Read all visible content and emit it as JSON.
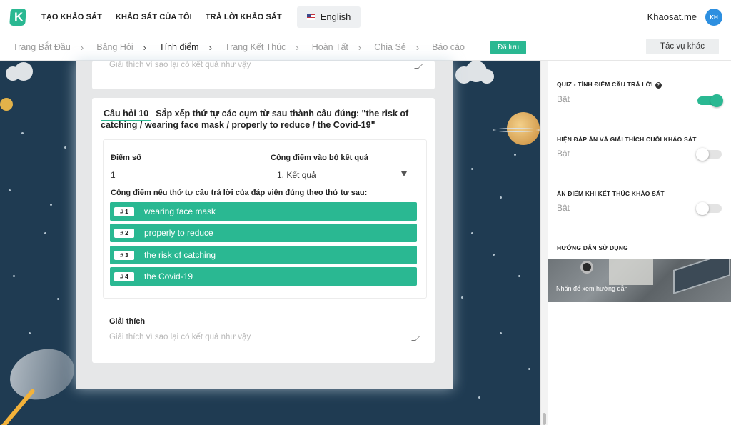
{
  "nav": {
    "links": [
      "TẠO KHẢO SÁT",
      "KHẢO SÁT CỦA TÔI",
      "TRẢ LỜI KHẢO SÁT"
    ],
    "language": "English",
    "brand": "Khaosat.me",
    "avatar": "KH"
  },
  "steps": {
    "items": [
      "Trang Bắt Đầu",
      "Bảng Hỏi",
      "Tính điểm",
      "Trang Kết Thúc",
      "Hoàn Tất",
      "Chia Sẻ",
      "Báo cáo"
    ],
    "active": "Tính điểm",
    "saved_badge": "Đã lưu",
    "other_button": "Tác vụ khác"
  },
  "prev_card": {
    "explain_placeholder": "Giải thích vì sao lại có kết quả như vậy"
  },
  "question": {
    "number": "Câu hỏi 10",
    "text": "Sắp xếp thứ tự các cụm từ sau thành câu đúng: \"the risk of catching / wearing face mask / properly to reduce / the Covid-19\"",
    "score_label": "Điểm số",
    "score_value": "1",
    "result_label": "Cộng điểm vào bộ kết quả",
    "result_value": "1. Kết quả",
    "order_label": "Cộng điểm nếu thứ tự câu trả lời của đáp viên đúng theo thứ tự sau:",
    "order_items": [
      {
        "tag": "# 1",
        "text": "wearing face mask"
      },
      {
        "tag": "# 2",
        "text": "properly to reduce"
      },
      {
        "tag": "# 3",
        "text": "the risk of catching"
      },
      {
        "tag": "# 4",
        "text": "the Covid-19"
      }
    ],
    "explain_label": "Giải thích",
    "explain_placeholder": "Giải thích vì sao lại có kết quả như vậy"
  },
  "sidebar": {
    "options": [
      {
        "title": "QUIZ - TÍNH ĐIỂM CÂU TRẢ LỜI",
        "value": "Bật",
        "on": true,
        "help": "?"
      },
      {
        "title": "HIỆN ĐÁP ÁN VÀ GIẢI THÍCH CUỐI KHẢO SÁT",
        "value": "Bật",
        "on": false
      },
      {
        "title": "ẨN ĐIỂM KHI KẾT THÚC KHẢO SÁT",
        "value": "Bật",
        "on": false
      }
    ],
    "guide_title": "HƯỚNG DẪN SỬ DỤNG",
    "guide_text": "Nhấn để xem hướng dẫn"
  },
  "colors": {
    "accent": "#2ab892",
    "canvas_bg": "#1f3b52",
    "avatar_bg": "#2d8fe0"
  }
}
